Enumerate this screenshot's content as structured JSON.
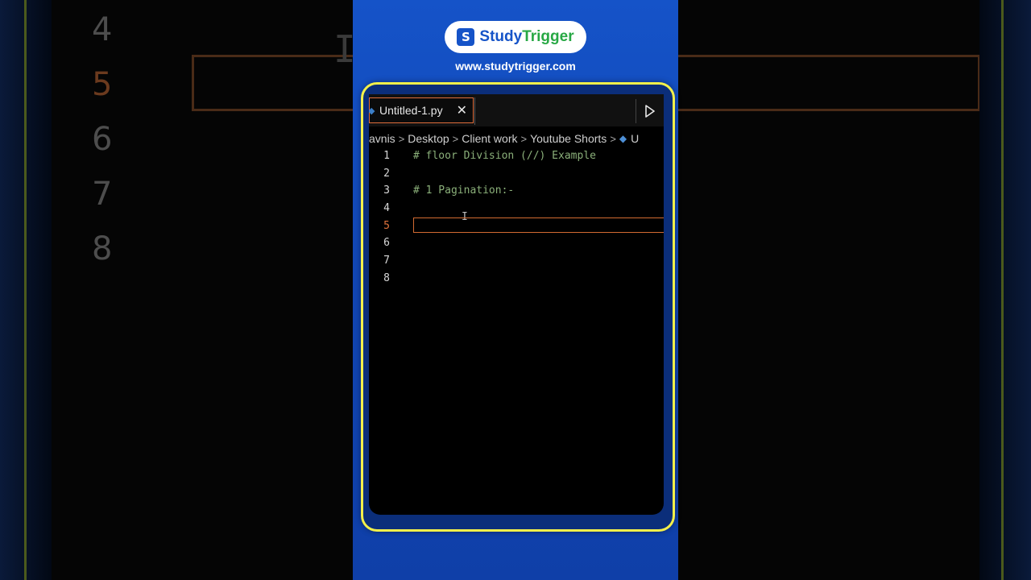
{
  "brand": {
    "logo_letter": "S",
    "name_part1": "Study",
    "name_part2": "Trigger",
    "url": "www.studytrigger.com"
  },
  "background_zoom": {
    "line_numbers": [
      "4",
      "5",
      "6",
      "7",
      "8"
    ],
    "active_line": "5"
  },
  "editor": {
    "tab": {
      "icon": "python-file-icon",
      "title": "Untitled-1.py",
      "close_glyph": "✕"
    },
    "run_icon": "play-icon",
    "breadcrumbs": [
      "avnis",
      "Desktop",
      "Client work",
      "Youtube Shorts",
      "U"
    ],
    "lines": [
      {
        "number": "1",
        "text": "# floor Division (//) Example"
      },
      {
        "number": "2",
        "text": ""
      },
      {
        "number": "3",
        "text": "# 1 Pagination:-"
      },
      {
        "number": "4",
        "text": ""
      },
      {
        "number": "5",
        "text": ""
      },
      {
        "number": "6",
        "text": ""
      },
      {
        "number": "7",
        "text": ""
      },
      {
        "number": "8",
        "text": ""
      }
    ],
    "active_line": "5"
  },
  "colors": {
    "panel_blue": "#1553c8",
    "frame_yellow": "#f4f04a",
    "active_line_orange": "#e0733c",
    "comment_green": "#8bb07a"
  }
}
